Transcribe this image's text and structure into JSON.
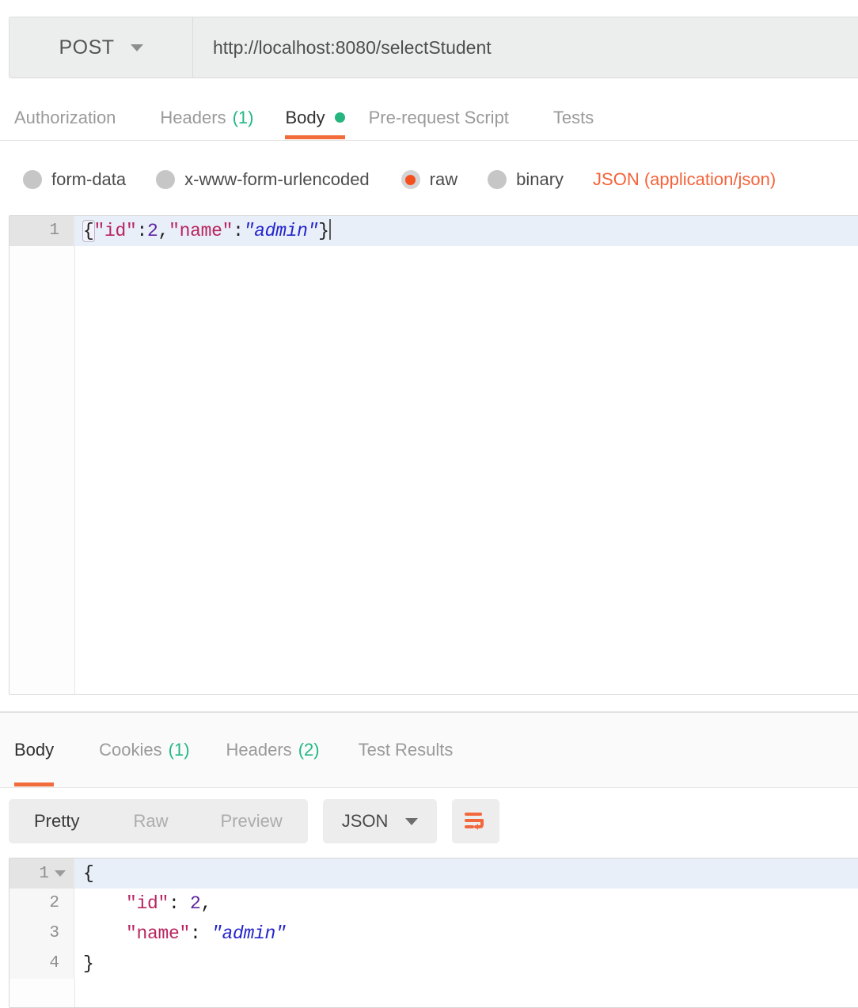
{
  "request": {
    "method": "POST",
    "url": "http://localhost:8080/selectStudent",
    "tabs": [
      {
        "label": "Authorization",
        "count": "",
        "active": false
      },
      {
        "label": "Headers",
        "count": "(1)",
        "active": false
      },
      {
        "label": "Body",
        "count": "",
        "active": true
      },
      {
        "label": "Pre-request Script",
        "count": "",
        "active": false
      },
      {
        "label": "Tests",
        "count": "",
        "active": false
      }
    ],
    "body_types": [
      {
        "label": "form-data",
        "selected": false
      },
      {
        "label": "x-www-form-urlencoded",
        "selected": false
      },
      {
        "label": "raw",
        "selected": true
      },
      {
        "label": "binary",
        "selected": false
      }
    ],
    "content_type": "JSON (application/json)",
    "body_lines": [
      {
        "number": "1",
        "text": "{\"id\":2,\"name\":\"admin\"}"
      }
    ]
  },
  "response": {
    "tabs": [
      {
        "label": "Body",
        "count": "",
        "active": true
      },
      {
        "label": "Cookies",
        "count": "(1)",
        "active": false
      },
      {
        "label": "Headers",
        "count": "(2)",
        "active": false
      },
      {
        "label": "Test Results",
        "count": "",
        "active": false
      }
    ],
    "view_modes": [
      {
        "label": "Pretty",
        "active": true
      },
      {
        "label": "Raw",
        "active": false
      },
      {
        "label": "Preview",
        "active": false
      }
    ],
    "format": "JSON",
    "wrap_icon": "word-wrap-icon",
    "body_lines": [
      {
        "number": "1",
        "text": "{"
      },
      {
        "number": "2",
        "text": "    \"id\": 2,"
      },
      {
        "number": "3",
        "text": "    \"name\": \"admin\""
      },
      {
        "number": "4",
        "text": "}"
      }
    ]
  },
  "colors": {
    "accent": "#f26b3a",
    "count_green": "#22b884",
    "json_key": "#b8255f",
    "json_number": "#5d22a0",
    "json_string": "#2424cc"
  }
}
